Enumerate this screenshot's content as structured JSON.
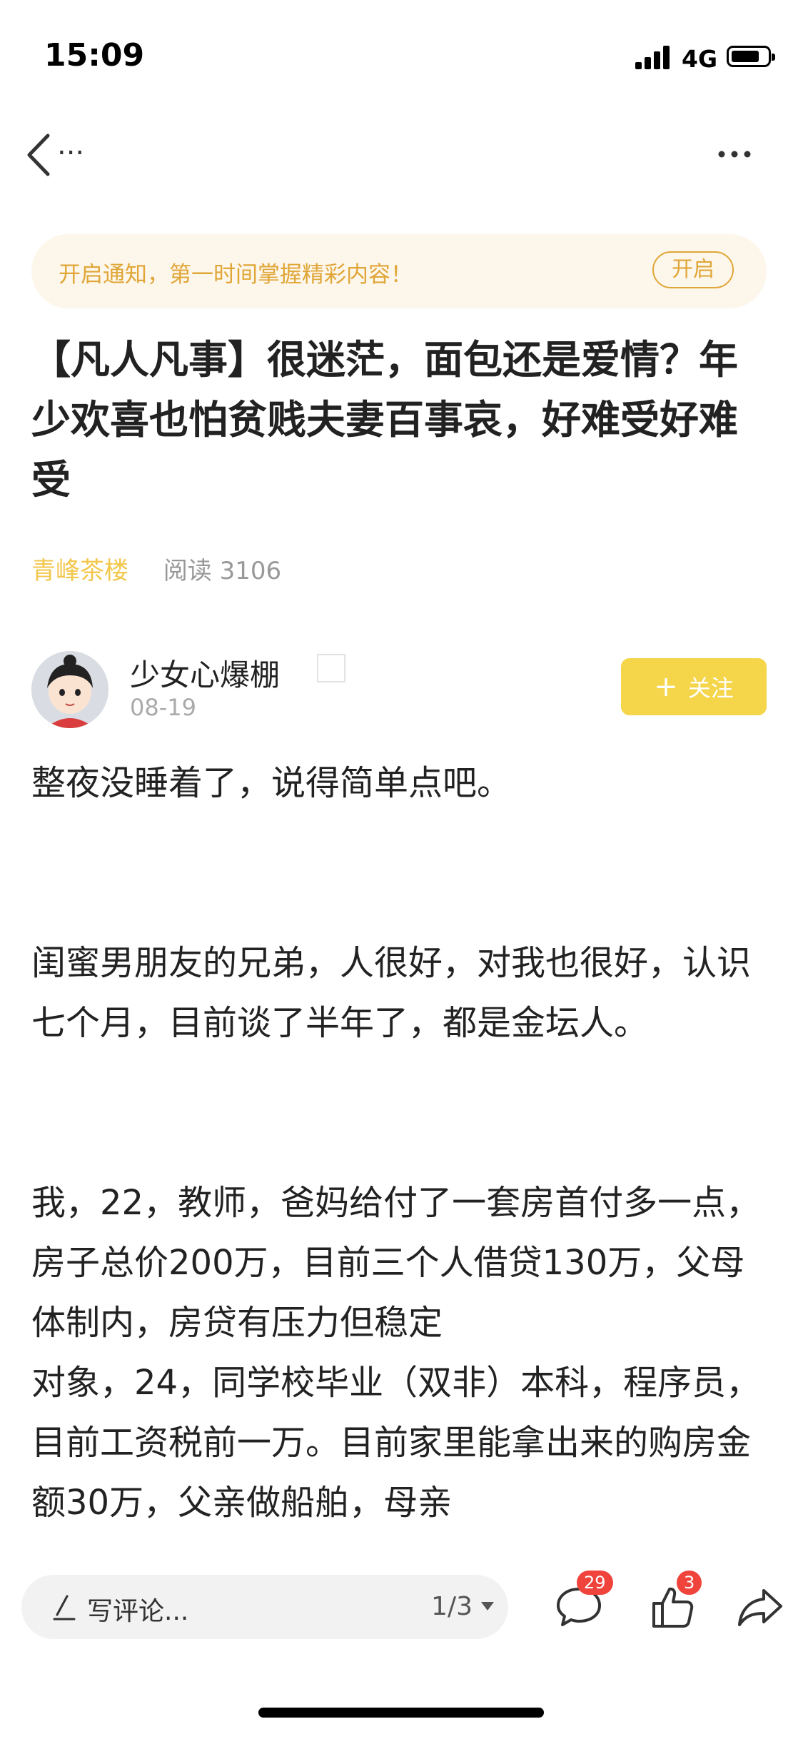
{
  "status_bar": {
    "time": "15:09",
    "network": "4G"
  },
  "nav": {
    "back_ellipsis": "..."
  },
  "notify": {
    "text": "开启通知，第一时间掌握精彩内容！",
    "button": "开启"
  },
  "article": {
    "title": "【凡人凡事】很迷茫，面包还是爱情？年少欢喜也怕贫贱夫妻百事哀，好难受好难受",
    "source": "青峰茶楼",
    "reads": "阅读 3106",
    "paragraphs": [
      "整夜没睡着了，说得简单点吧。",
      "闺蜜男朋友的兄弟，人很好，对我也很好，认识七个月，目前谈了半年了，都是金坛人。",
      "我，22，教师，爸妈给付了一套房首付多一点，房子总价200万，目前三个人借贷130万，父母体制内，房贷有压力但稳定",
      "对象，24，同学校毕业（双非）本科，程序员，目前工资税前一万。目前家里能拿出来的购房金额30万，父亲做船舶，母亲"
    ]
  },
  "author": {
    "name": "少女心爆棚",
    "date": "08-19",
    "follow_label": "关注",
    "follow_plus": "+"
  },
  "bottom_bar": {
    "comment_placeholder": "写评论...",
    "page_indicator": "1/3",
    "comment_count": "29",
    "like_count": "3"
  },
  "colors": {
    "accent_yellow": "#f5d54a",
    "notify_orange": "#e0a637",
    "badge_red": "#f0433c"
  }
}
